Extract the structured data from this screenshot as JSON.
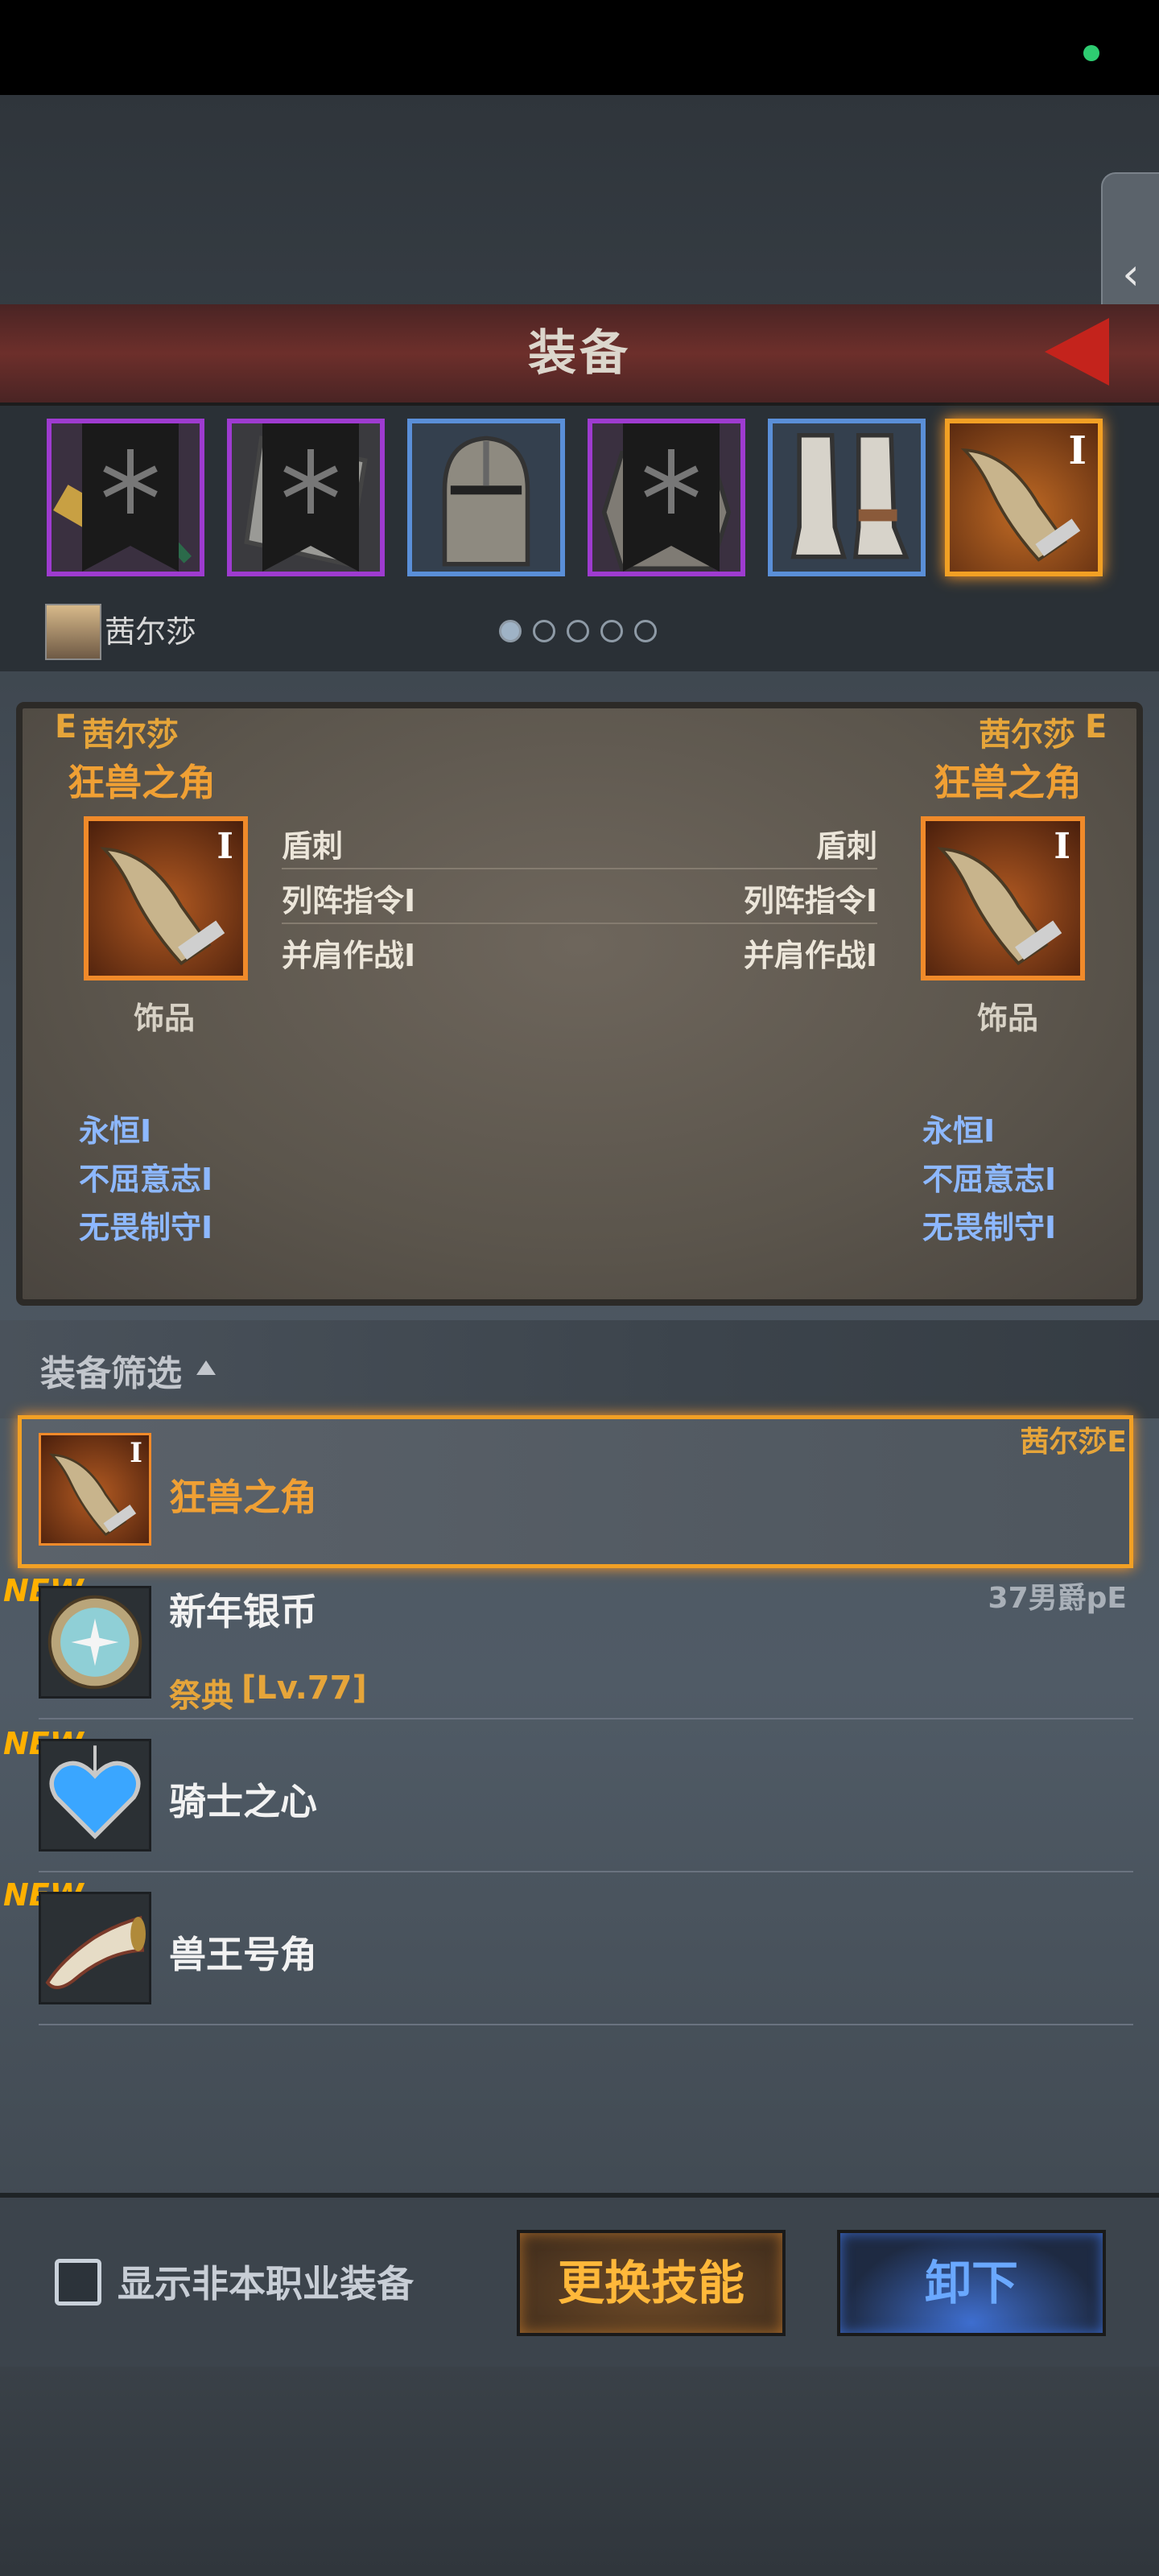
{
  "header": {
    "title": "装备"
  },
  "character": {
    "name": "茜尔莎"
  },
  "slots": [
    {
      "name": "pickaxe",
      "rarity": "purple"
    },
    {
      "name": "tower-shield",
      "rarity": "purple"
    },
    {
      "name": "great-helm",
      "rarity": "blue"
    },
    {
      "name": "chainmail-armor",
      "rarity": "purple"
    },
    {
      "name": "plate-boots",
      "rarity": "blue"
    },
    {
      "name": "beast-horn",
      "rarity": "orange",
      "tier": "I"
    }
  ],
  "compare": {
    "left": {
      "owner": "茜尔莎",
      "owner_prefix": "E",
      "item": "狂兽之角",
      "tier": "I",
      "category": "饰品",
      "skills": [
        "盾刺",
        "列阵指令I",
        "并肩作战I"
      ],
      "runes": [
        "永恒I",
        "不屈意志I",
        "无畏制守I"
      ]
    },
    "right": {
      "owner": "茜尔莎",
      "owner_suffix": "E",
      "item": "狂兽之角",
      "tier": "I",
      "category": "饰品",
      "skills": [
        "盾刺",
        "列阵指令I",
        "并肩作战I"
      ],
      "runes": [
        "永恒I",
        "不屈意志I",
        "无畏制守I"
      ]
    }
  },
  "filter": {
    "label": "装备筛选"
  },
  "items": [
    {
      "name": "狂兽之角",
      "owner": "茜尔莎E",
      "tier": "I",
      "selected": true,
      "new": false
    },
    {
      "name": "新年银币",
      "owner": "37男爵pE",
      "sub": "祭典",
      "level": "[Lv.77]",
      "new": true,
      "new_label": "NEW"
    },
    {
      "name": "骑士之心",
      "new": true,
      "new_label": "NEW"
    },
    {
      "name": "兽王号角",
      "new": true,
      "new_label": "NEW"
    }
  ],
  "bottom": {
    "checkbox_label": "显示非本职业装备",
    "btn_skill": "更换技能",
    "btn_unequip": "卸下"
  },
  "colors": {
    "accent_orange": "#f2a024",
    "rarity_purple": "#9e3bd0",
    "rarity_blue": "#5a8fd8",
    "rune_blue": "#8db8ff"
  }
}
